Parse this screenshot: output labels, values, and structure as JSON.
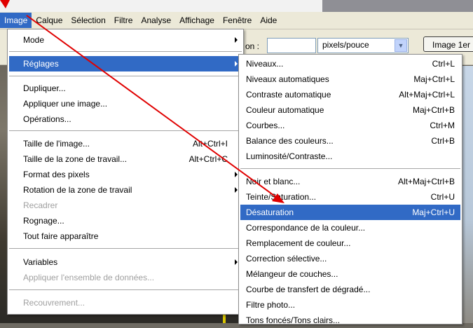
{
  "menubar": {
    "items": [
      "Image",
      "Calque",
      "Sélection",
      "Filtre",
      "Analyse",
      "Affichage",
      "Fenêtre",
      "Aide"
    ],
    "active_index": 0
  },
  "options": {
    "resolution_label": "on :",
    "resolution_value": "",
    "units_value": "pixels/pouce",
    "front_image_label": "Image 1er"
  },
  "image_menu": {
    "mode": "Mode",
    "reglages": "Réglages",
    "dupliquer": "Dupliquer...",
    "appliquer_image": "Appliquer une image...",
    "operations": "Opérations...",
    "taille_image": "Taille de l'image...",
    "taille_image_sc": "Alt+Ctrl+I",
    "taille_zone": "Taille de la zone de travail...",
    "taille_zone_sc": "Alt+Ctrl+C",
    "format_pixels": "Format des pixels",
    "rotation": "Rotation de la zone de travail",
    "recadrer": "Recadrer",
    "rognage": "Rognage...",
    "tout_faire": "Tout faire apparaître",
    "variables": "Variables",
    "appliquer_ensemble": "Appliquer l'ensemble de données...",
    "recouvrement": "Recouvrement..."
  },
  "adjust_menu": {
    "items": [
      {
        "label": "Niveaux...",
        "shortcut": "Ctrl+L"
      },
      {
        "label": "Niveaux automatiques",
        "shortcut": "Maj+Ctrl+L"
      },
      {
        "label": "Contraste automatique",
        "shortcut": "Alt+Maj+Ctrl+L"
      },
      {
        "label": "Couleur automatique",
        "shortcut": "Maj+Ctrl+B"
      },
      {
        "label": "Courbes...",
        "shortcut": "Ctrl+M"
      },
      {
        "label": "Balance des couleurs...",
        "shortcut": "Ctrl+B"
      },
      {
        "label": "Luminosité/Contraste...",
        "shortcut": ""
      },
      {
        "label": "Noir et blanc...",
        "shortcut": "Alt+Maj+Ctrl+B"
      },
      {
        "label": "Teinte/Saturation...",
        "shortcut": "Ctrl+U"
      },
      {
        "label": "Désaturation",
        "shortcut": "Maj+Ctrl+U"
      },
      {
        "label": "Correspondance de la couleur...",
        "shortcut": ""
      },
      {
        "label": "Remplacement de couleur...",
        "shortcut": ""
      },
      {
        "label": "Correction sélective...",
        "shortcut": ""
      },
      {
        "label": "Mélangeur de couches...",
        "shortcut": ""
      },
      {
        "label": "Courbe de transfert de dégradé...",
        "shortcut": ""
      },
      {
        "label": "Filtre photo...",
        "shortcut": ""
      },
      {
        "label": "Tons foncés/Tons clairs...",
        "shortcut": ""
      }
    ]
  },
  "colors": {
    "highlight": "#316ac5",
    "annotation_arrow": "#e00000",
    "menubar_bg": "#ece9d8"
  }
}
